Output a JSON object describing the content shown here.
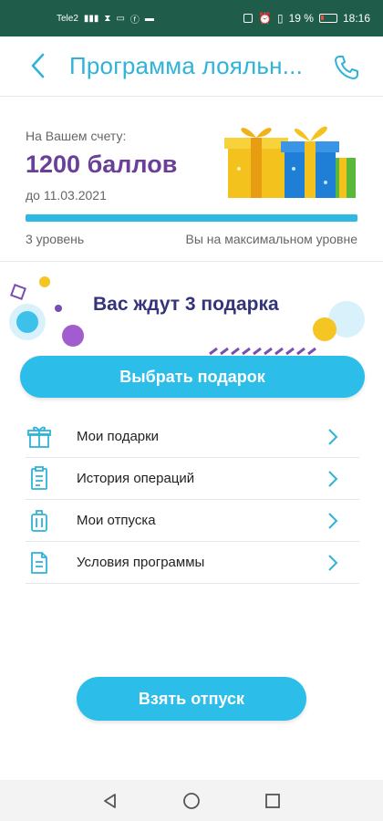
{
  "status_bar": {
    "carrier": "Tele2",
    "battery": "19 %",
    "time": "18:16"
  },
  "header": {
    "title": "Программа лояльн...",
    "back_icon": "chevron-left-icon",
    "phone_icon": "phone-icon"
  },
  "balance": {
    "caption": "На Вашем счету:",
    "points": "1200 баллов",
    "valid_until": "до 11.03.2021",
    "progress_fraction": 1.0,
    "level": "3 уровень",
    "level_status": "Вы на максимальном уровне"
  },
  "promo": {
    "text": "Вас ждут 3 подарка",
    "button": "Выбрать подарок"
  },
  "menu": [
    {
      "label": "Мои подарки",
      "icon": "gift-icon"
    },
    {
      "label": "История операций",
      "icon": "receipt-icon"
    },
    {
      "label": "Мои отпуска",
      "icon": "suitcase-icon"
    },
    {
      "label": "Условия программы",
      "icon": "document-icon"
    }
  ],
  "vacation_button": "Взять отпуск",
  "colors": {
    "accent": "#2dbde9",
    "title": "#2fb3d9",
    "points": "#6a3f99",
    "promo_text": "#33347a",
    "status_bar": "#1f5d4a"
  }
}
